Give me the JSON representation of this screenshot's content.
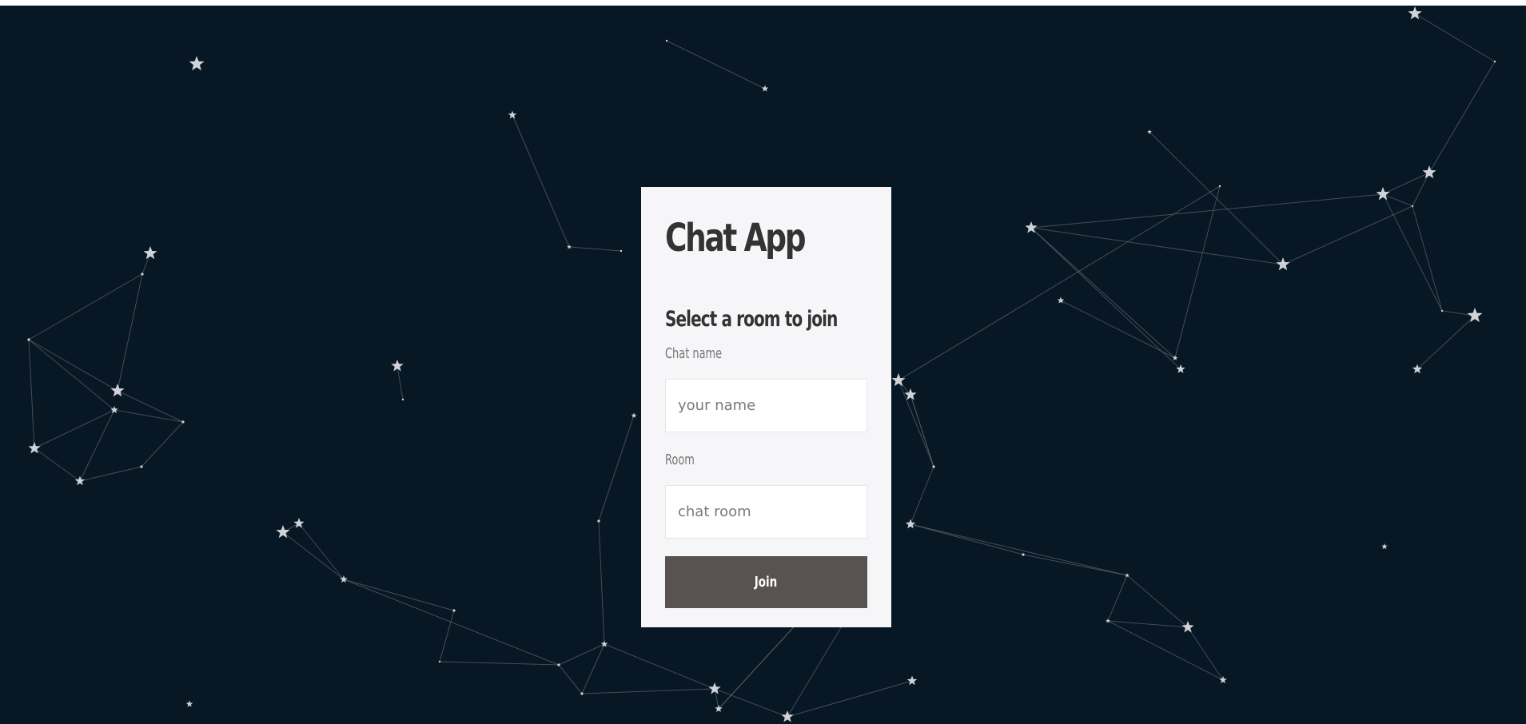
{
  "colors": {
    "background": "#081724",
    "card": "#f6f6f8",
    "button": "#585251",
    "text": "#333333",
    "label": "#767676",
    "star": "#cfd3d8",
    "link": "#56606b"
  },
  "card": {
    "title": "Chat App",
    "subtitle": "Select a room to join",
    "name_label": "Chat name",
    "name_placeholder": "your name",
    "room_label": "Room",
    "room_placeholder": "chat room",
    "join_label": "Join"
  },
  "background": {
    "icon": "star-icon",
    "description_type": "animated constellation network"
  }
}
